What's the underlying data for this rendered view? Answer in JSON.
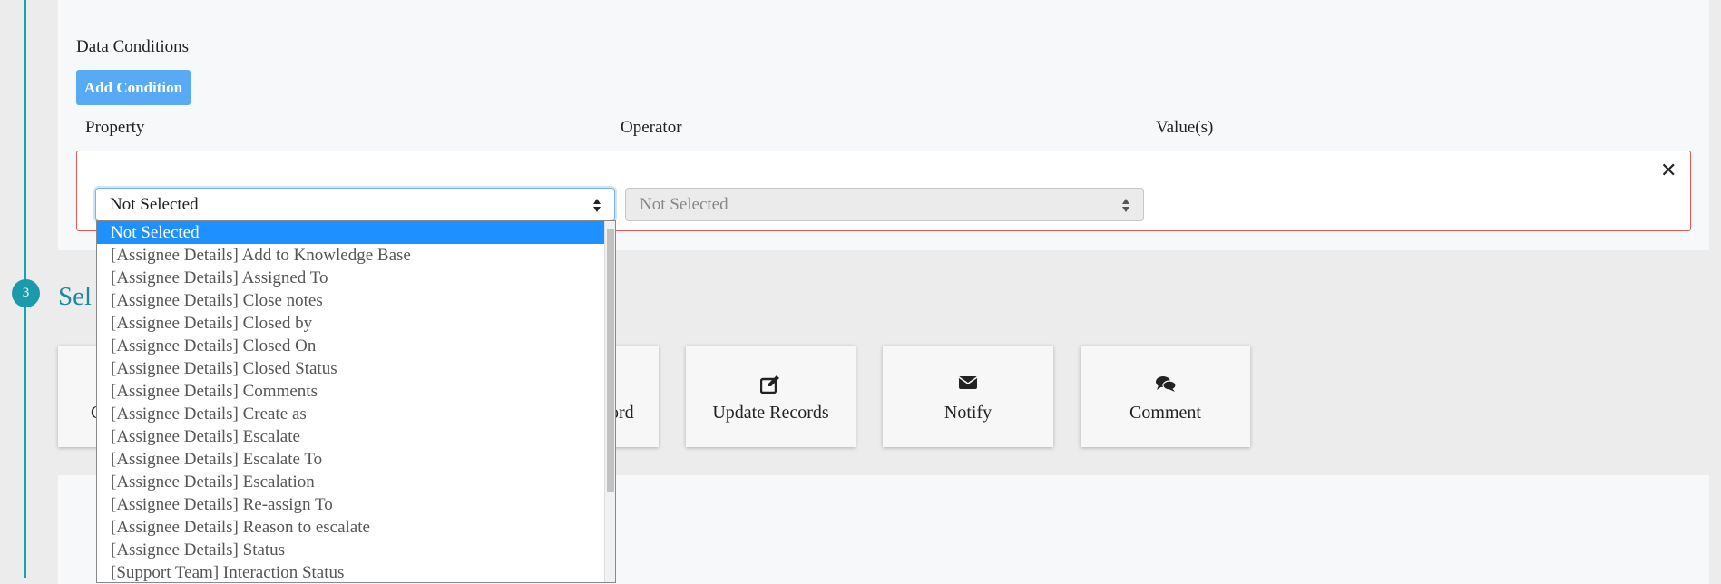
{
  "conditions": {
    "heading": "Data Conditions",
    "add_button": "Add Condition",
    "columns": {
      "property": "Property",
      "operator": "Operator",
      "values": "Value(s)"
    },
    "row": {
      "property_value": "Not Selected",
      "operator_value": "Not Selected",
      "remove_icon": "close-icon",
      "border_color": "#e45a5a"
    }
  },
  "step": {
    "number": "3",
    "title_visible": "Sel"
  },
  "actions": {
    "card_left_partial": "C",
    "card_mid_partial": "ord",
    "cards": [
      {
        "label": "Update Records",
        "icon": "edit-icon"
      },
      {
        "label": "Notify",
        "icon": "envelope-icon"
      },
      {
        "label": "Comment",
        "icon": "comments-icon"
      }
    ]
  },
  "dropdown": {
    "options": [
      "Not Selected",
      "[Assignee Details] Add to Knowledge Base",
      "[Assignee Details] Assigned To",
      "[Assignee Details] Close notes",
      "[Assignee Details] Closed by",
      "[Assignee Details] Closed On",
      "[Assignee Details] Closed Status",
      "[Assignee Details] Comments",
      "[Assignee Details] Create as",
      "[Assignee Details] Escalate",
      "[Assignee Details] Escalate To",
      "[Assignee Details] Escalation",
      "[Assignee Details] Re-assign To",
      "[Assignee Details] Reason to escalate",
      "[Assignee Details] Status",
      "[Support Team] Interaction Status"
    ],
    "selected_index": 0
  },
  "colors": {
    "accent": "#1a9aaa",
    "button": "#58aaf5",
    "highlight": "#1e90ff",
    "error": "#e45a5a"
  }
}
